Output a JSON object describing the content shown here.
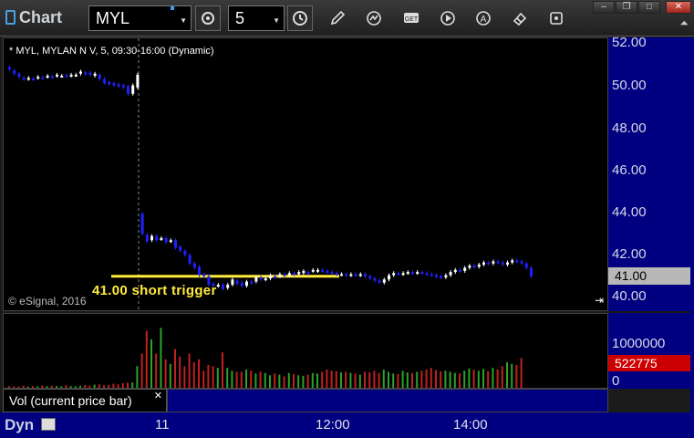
{
  "toolbar": {
    "app_title": "Chart",
    "symbol": "MYL",
    "interval": "5"
  },
  "chart": {
    "header": "* MYL, MYLAN N V, 5, 09:30-16:00 (Dynamic)",
    "copyright": "© eSignal, 2016",
    "annotation": "41.00 short trigger",
    "annotation_color": "#ffeb3b",
    "up_color": "#ffffff",
    "down_color": "#2020ff"
  },
  "price_axis": {
    "ticks": [
      "52.00",
      "50.00",
      "48.00",
      "46.00",
      "44.00",
      "42.00",
      "40.00"
    ],
    "last_price": "41.00"
  },
  "volume": {
    "legend": "Vol (current price bar)",
    "ticks": [
      "1000000",
      "0"
    ],
    "last_value": "522775"
  },
  "time_axis": {
    "mode": "Dyn",
    "labels": [
      "11",
      "12:00",
      "14:00"
    ]
  },
  "chart_data": {
    "type": "candlestick",
    "ylim": [
      40.0,
      52.0
    ],
    "annotation_level": 41.0,
    "session_marker_index": 27,
    "bars": [
      {
        "o": 50.85,
        "c": 50.75
      },
      {
        "o": 50.7,
        "c": 50.55
      },
      {
        "o": 50.55,
        "c": 50.4
      },
      {
        "o": 50.35,
        "c": 50.3
      },
      {
        "o": 50.3,
        "c": 50.35
      },
      {
        "o": 50.32,
        "c": 50.3
      },
      {
        "o": 50.35,
        "c": 50.4
      },
      {
        "o": 50.38,
        "c": 50.35
      },
      {
        "o": 50.4,
        "c": 50.45
      },
      {
        "o": 50.42,
        "c": 50.38
      },
      {
        "o": 50.45,
        "c": 50.5
      },
      {
        "o": 50.45,
        "c": 50.45
      },
      {
        "o": 50.48,
        "c": 50.42
      },
      {
        "o": 50.45,
        "c": 50.5
      },
      {
        "o": 50.48,
        "c": 50.5
      },
      {
        "o": 50.55,
        "c": 50.65
      },
      {
        "o": 50.6,
        "c": 50.55
      },
      {
        "o": 50.6,
        "c": 50.5
      },
      {
        "o": 50.45,
        "c": 50.55
      },
      {
        "o": 50.5,
        "c": 50.3
      },
      {
        "o": 50.3,
        "c": 50.1
      },
      {
        "o": 50.15,
        "c": 50.05
      },
      {
        "o": 50.1,
        "c": 50.0
      },
      {
        "o": 50.05,
        "c": 49.95
      },
      {
        "o": 50.0,
        "c": 49.9
      },
      {
        "o": 49.95,
        "c": 49.6
      },
      {
        "o": 49.6,
        "c": 50.0
      },
      {
        "o": 49.9,
        "c": 50.5
      },
      {
        "o": 43.95,
        "c": 43.0
      },
      {
        "o": 42.95,
        "c": 42.65
      },
      {
        "o": 42.7,
        "c": 42.9
      },
      {
        "o": 42.9,
        "c": 42.7
      },
      {
        "o": 42.75,
        "c": 42.8
      },
      {
        "o": 42.8,
        "c": 42.6
      },
      {
        "o": 42.65,
        "c": 42.7
      },
      {
        "o": 42.7,
        "c": 42.35
      },
      {
        "o": 42.4,
        "c": 42.2
      },
      {
        "o": 42.2,
        "c": 42.0
      },
      {
        "o": 42.0,
        "c": 41.6
      },
      {
        "o": 41.6,
        "c": 41.4
      },
      {
        "o": 41.45,
        "c": 41.05
      },
      {
        "o": 41.1,
        "c": 41.0
      },
      {
        "o": 41.0,
        "c": 40.6
      },
      {
        "o": 40.65,
        "c": 40.55
      },
      {
        "o": 40.55,
        "c": 40.6
      },
      {
        "o": 40.6,
        "c": 40.4
      },
      {
        "o": 40.45,
        "c": 40.6
      },
      {
        "o": 40.6,
        "c": 40.85
      },
      {
        "o": 40.8,
        "c": 40.65
      },
      {
        "o": 40.7,
        "c": 40.55
      },
      {
        "o": 40.55,
        "c": 40.75
      },
      {
        "o": 40.75,
        "c": 40.7
      },
      {
        "o": 40.75,
        "c": 40.95
      },
      {
        "o": 40.95,
        "c": 40.85
      },
      {
        "o": 40.85,
        "c": 40.9
      },
      {
        "o": 40.9,
        "c": 41.05
      },
      {
        "o": 41.0,
        "c": 40.95
      },
      {
        "o": 41.0,
        "c": 41.1
      },
      {
        "o": 41.1,
        "c": 41.05
      },
      {
        "o": 41.05,
        "c": 41.15
      },
      {
        "o": 41.15,
        "c": 41.1
      },
      {
        "o": 41.1,
        "c": 41.2
      },
      {
        "o": 41.15,
        "c": 41.25
      },
      {
        "o": 41.2,
        "c": 41.15
      },
      {
        "o": 41.25,
        "c": 41.3
      },
      {
        "o": 41.25,
        "c": 41.3
      },
      {
        "o": 41.3,
        "c": 41.25
      },
      {
        "o": 41.25,
        "c": 41.2
      },
      {
        "o": 41.2,
        "c": 41.15
      },
      {
        "o": 41.15,
        "c": 41.1
      },
      {
        "o": 41.1,
        "c": 41.1
      },
      {
        "o": 41.1,
        "c": 41.05
      },
      {
        "o": 41.05,
        "c": 41.1
      },
      {
        "o": 41.1,
        "c": 41.05
      },
      {
        "o": 41.05,
        "c": 41.1
      },
      {
        "o": 41.1,
        "c": 41.0
      },
      {
        "o": 41.0,
        "c": 40.9
      },
      {
        "o": 40.9,
        "c": 40.8
      },
      {
        "o": 40.8,
        "c": 40.7
      },
      {
        "o": 40.7,
        "c": 40.85
      },
      {
        "o": 40.85,
        "c": 41.05
      },
      {
        "o": 41.05,
        "c": 41.15
      },
      {
        "o": 41.15,
        "c": 41.1
      },
      {
        "o": 41.1,
        "c": 41.15
      },
      {
        "o": 41.15,
        "c": 41.2
      },
      {
        "o": 41.2,
        "c": 41.15
      },
      {
        "o": 41.15,
        "c": 41.2
      },
      {
        "o": 41.2,
        "c": 41.15
      },
      {
        "o": 41.15,
        "c": 41.1
      },
      {
        "o": 41.1,
        "c": 41.05
      },
      {
        "o": 41.05,
        "c": 41.0
      },
      {
        "o": 41.0,
        "c": 40.95
      },
      {
        "o": 40.95,
        "c": 41.05
      },
      {
        "o": 41.05,
        "c": 41.2
      },
      {
        "o": 41.2,
        "c": 41.3
      },
      {
        "o": 41.3,
        "c": 41.25
      },
      {
        "o": 41.25,
        "c": 41.4
      },
      {
        "o": 41.4,
        "c": 41.5
      },
      {
        "o": 41.5,
        "c": 41.45
      },
      {
        "o": 41.45,
        "c": 41.55
      },
      {
        "o": 41.55,
        "c": 41.65
      },
      {
        "o": 41.65,
        "c": 41.6
      },
      {
        "o": 41.6,
        "c": 41.7
      },
      {
        "o": 41.7,
        "c": 41.65
      },
      {
        "o": 41.65,
        "c": 41.55
      },
      {
        "o": 41.55,
        "c": 41.65
      },
      {
        "o": 41.65,
        "c": 41.75
      },
      {
        "o": 41.75,
        "c": 41.7
      },
      {
        "o": 41.7,
        "c": 41.6
      },
      {
        "o": 41.6,
        "c": 41.4
      },
      {
        "o": 41.4,
        "c": 41.0
      }
    ],
    "volumes": [
      30000,
      25000,
      20000,
      35000,
      22000,
      30000,
      25000,
      40000,
      28000,
      35000,
      30000,
      25000,
      45000,
      30000,
      28000,
      35000,
      50000,
      40000,
      55000,
      60000,
      45000,
      50000,
      70000,
      60000,
      80000,
      90000,
      95000,
      380000,
      600000,
      1000000,
      850000,
      600000,
      1050000,
      500000,
      420000,
      680000,
      550000,
      380000,
      600000,
      450000,
      500000,
      300000,
      400000,
      380000,
      350000,
      620000,
      350000,
      300000,
      280000,
      280000,
      320000,
      300000,
      250000,
      280000,
      260000,
      220000,
      250000,
      230000,
      200000,
      260000,
      240000,
      220000,
      210000,
      230000,
      260000,
      250000,
      280000,
      320000,
      300000,
      290000,
      270000,
      280000,
      260000,
      250000,
      230000,
      280000,
      270000,
      300000,
      260000,
      320000,
      280000,
      250000,
      240000,
      300000,
      270000,
      260000,
      280000,
      300000,
      320000,
      350000,
      310000,
      290000,
      300000,
      280000,
      260000,
      250000,
      300000,
      340000,
      320000,
      300000,
      330000,
      290000,
      350000,
      320000,
      380000,
      450000,
      420000,
      400000,
      522775
    ]
  }
}
